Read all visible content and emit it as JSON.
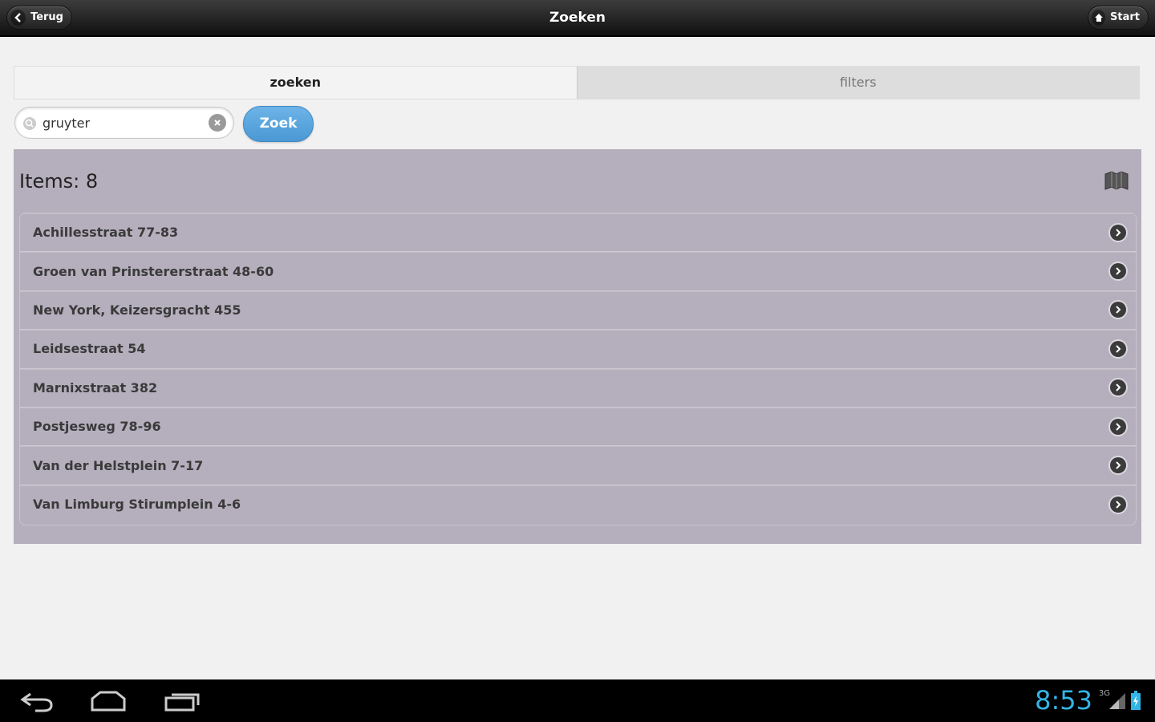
{
  "header": {
    "title": "Zoeken",
    "back_label": "Terug",
    "home_label": "Start"
  },
  "tabs": [
    {
      "label": "zoeken",
      "active": true
    },
    {
      "label": "filters",
      "active": false
    }
  ],
  "search": {
    "value": "gruyter",
    "button_label": "Zoek"
  },
  "results": {
    "count_label": "Items: 8",
    "items": [
      {
        "label": "Achillesstraat 77-83"
      },
      {
        "label": "Groen van Prinstererstraat 48-60"
      },
      {
        "label": "New York, Keizersgracht 455"
      },
      {
        "label": "Leidsestraat 54"
      },
      {
        "label": "Marnixstraat 382"
      },
      {
        "label": "Postjesweg 78-96"
      },
      {
        "label": "Van der Helstplein 7-17"
      },
      {
        "label": "Van Limburg Stirumplein 4-6"
      }
    ]
  },
  "system": {
    "time": "8:53",
    "network": "3G"
  },
  "colors": {
    "accent": "#4a98d4",
    "list_bg": "#b5afbd",
    "clock": "#33b5e5"
  }
}
